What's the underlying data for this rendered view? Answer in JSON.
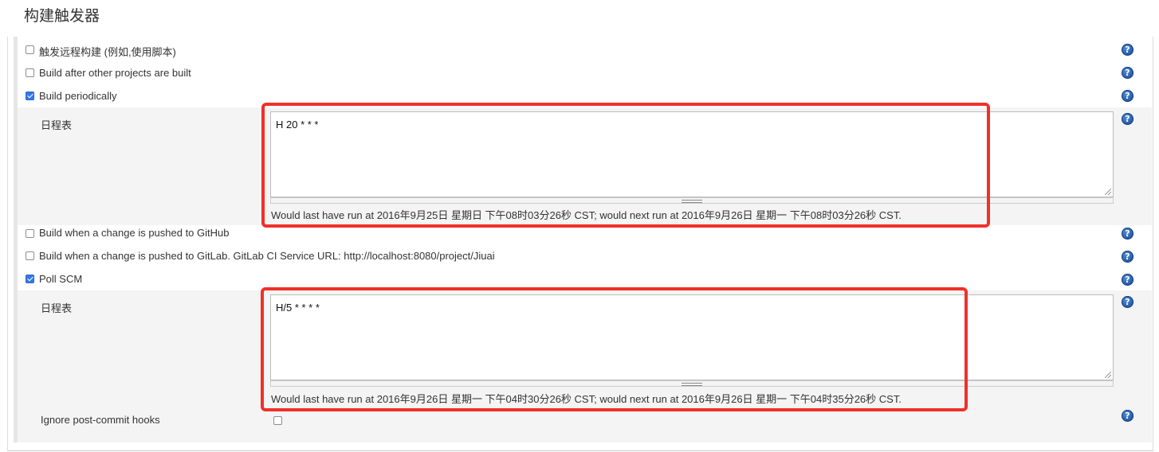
{
  "section": {
    "title": "构建触发器"
  },
  "triggers": {
    "remote_build": {
      "label": "触发远程构建 (例如,使用脚本)",
      "checked": false
    },
    "after_other_projects": {
      "label": "Build after other projects are built",
      "checked": false
    },
    "build_periodically": {
      "label": "Build periodically",
      "checked": true,
      "schedule_label": "日程表",
      "schedule_value": "H 20 * * *",
      "note": "Would last have run at 2016年9月25日 星期日 下午08时03分26秒 CST; would next run at 2016年9月26日 星期一 下午08时03分26秒 CST."
    },
    "github_push": {
      "label": "Build when a change is pushed to GitHub",
      "checked": false
    },
    "gitlab_push": {
      "label": "Build when a change is pushed to GitLab. GitLab CI Service URL: http://localhost:8080/project/Jiuai",
      "checked": false
    },
    "poll_scm": {
      "label": "Poll SCM",
      "checked": true,
      "schedule_label": "日程表",
      "schedule_value": "H/5 * * * *",
      "note": "Would last have run at 2016年9月26日 星期一 下午04时30分26秒 CST; would next run at 2016年9月26日 星期一 下午04时35分26秒 CST.",
      "ignore_hooks_label": "Ignore post-commit hooks",
      "ignore_hooks_checked": false
    }
  },
  "help_icon": {
    "glyph": "?"
  },
  "colors": {
    "highlight": "#f0302a",
    "checkbox_checked": "#3479e6",
    "help_icon": "#1d4f9a"
  }
}
